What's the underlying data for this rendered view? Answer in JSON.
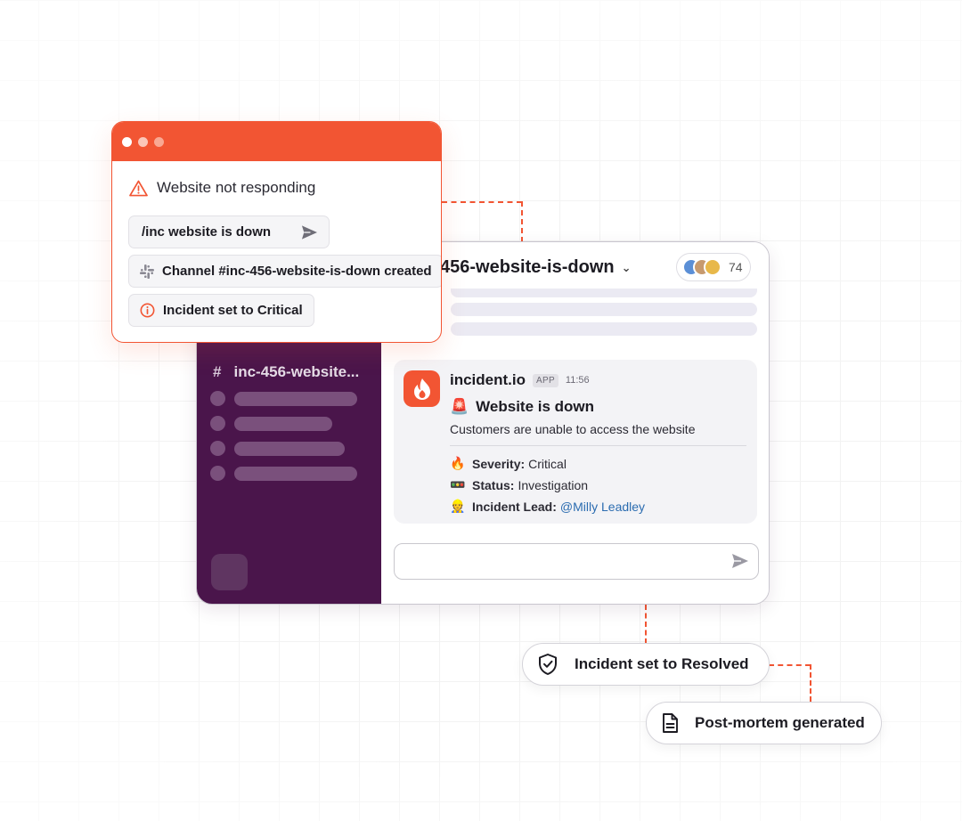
{
  "alert": {
    "title": "Website not responding",
    "command": "/inc website is down",
    "channel_created": "Channel #inc-456-website-is-down created",
    "severity_set": "Incident set to Critical"
  },
  "slack": {
    "sidebar_channel": "inc-456-website...",
    "channel_title": "456-website-is-down",
    "member_count": "74",
    "message": {
      "sender": "incident.io",
      "badge": "APP",
      "time": "11:56",
      "headline_emoji": "🚨",
      "headline": "Website is down",
      "subtitle": "Customers are unable to access the website",
      "fields": [
        {
          "emoji": "🔥",
          "label": "Severity:",
          "value": "Critical"
        },
        {
          "emoji": "🚥",
          "label": "Status:",
          "value": "Investigation"
        },
        {
          "emoji": "👷",
          "label": "Incident Lead:",
          "value": "@Milly Leadley"
        }
      ]
    }
  },
  "pills": {
    "resolved": "Incident set to Resolved",
    "postmortem": "Post-mortem generated"
  },
  "colors": {
    "accent": "#f25533",
    "slack_sidebar": "#4a154b",
    "link": "#2b6cb0"
  }
}
